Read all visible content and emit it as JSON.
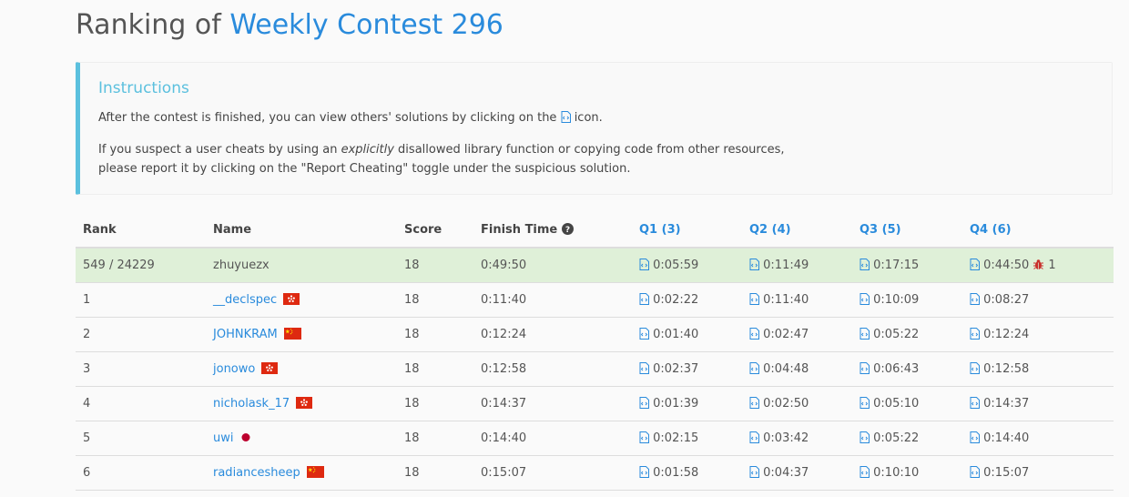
{
  "header": {
    "prefix": "Ranking of ",
    "contest": "Weekly Contest 296"
  },
  "instructions": {
    "title": "Instructions",
    "line1_before": "After the contest is finished, you can view others' solutions by clicking on the ",
    "line1_after": " icon.",
    "line2_before": "If you suspect a user cheats by using an ",
    "line2_emph": "explicitly",
    "line2_after": " disallowed library function or copying code from other resources,",
    "line3": "please report it by clicking on the \"Report Cheating\" toggle under the suspicious solution."
  },
  "table": {
    "columns": [
      "Rank",
      "Name",
      "Score",
      "Finish Time",
      "Q1 (3)",
      "Q2 (4)",
      "Q3 (5)",
      "Q4 (6)"
    ],
    "my_row": {
      "rank": "549 / 24229",
      "name": "zhuyuezx",
      "score": "18",
      "finish": "0:49:50",
      "q": [
        "0:05:59",
        "0:11:49",
        "0:17:15",
        "0:44:50"
      ],
      "penalty": "1"
    },
    "rows": [
      {
        "rank": "1",
        "name": "__declspec",
        "flag": "hk",
        "score": "18",
        "finish": "0:11:40",
        "q": [
          "0:02:22",
          "0:11:40",
          "0:10:09",
          "0:08:27"
        ]
      },
      {
        "rank": "2",
        "name": "JOHNKRAM",
        "flag": "cn",
        "score": "18",
        "finish": "0:12:24",
        "q": [
          "0:01:40",
          "0:02:47",
          "0:05:22",
          "0:12:24"
        ]
      },
      {
        "rank": "3",
        "name": "jonowo",
        "flag": "hk",
        "score": "18",
        "finish": "0:12:58",
        "q": [
          "0:02:37",
          "0:04:48",
          "0:06:43",
          "0:12:58"
        ]
      },
      {
        "rank": "4",
        "name": "nicholask_17",
        "flag": "hk",
        "score": "18",
        "finish": "0:14:37",
        "q": [
          "0:01:39",
          "0:02:50",
          "0:05:10",
          "0:14:37"
        ]
      },
      {
        "rank": "5",
        "name": "uwi",
        "flag": "jp",
        "score": "18",
        "finish": "0:14:40",
        "q": [
          "0:02:15",
          "0:03:42",
          "0:05:22",
          "0:14:40"
        ]
      },
      {
        "rank": "6",
        "name": "radiancesheep",
        "flag": "cn",
        "score": "18",
        "finish": "0:15:07",
        "q": [
          "0:01:58",
          "0:04:37",
          "0:10:10",
          "0:15:07"
        ]
      }
    ]
  },
  "colors": {
    "accent": "#2a8bdc",
    "info": "#5bc0de",
    "highlight_row": "#dff0d8"
  }
}
